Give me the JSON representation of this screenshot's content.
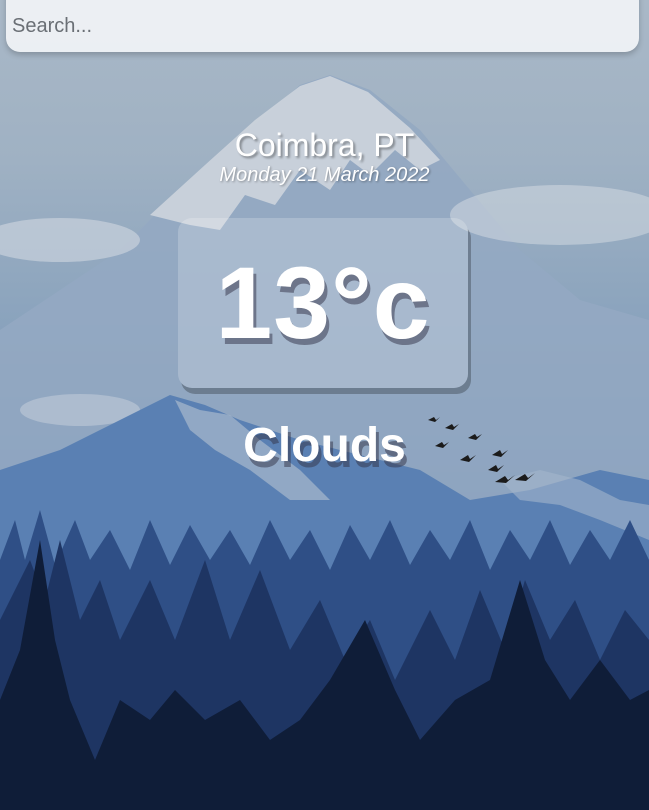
{
  "search": {
    "placeholder": "Search...",
    "value": ""
  },
  "location": {
    "city_country": "Coimbra, PT",
    "date": "Monday 21 March 2022"
  },
  "weather": {
    "temperature": "13°c",
    "description": "Clouds"
  }
}
